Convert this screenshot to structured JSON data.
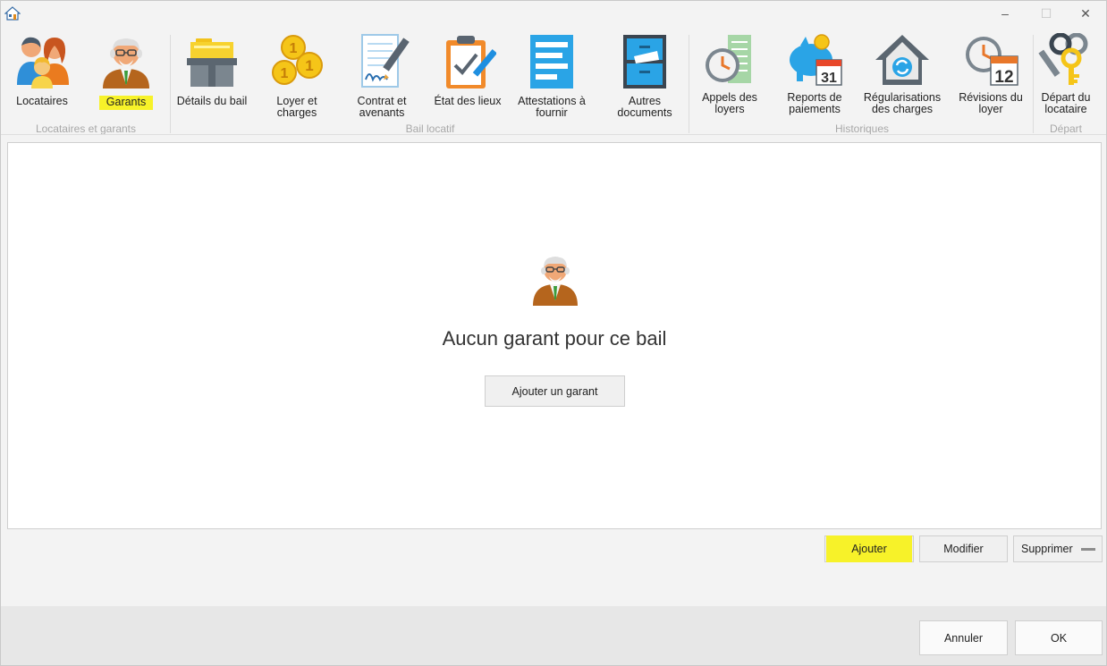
{
  "window": {
    "app_icon": "house-icon",
    "controls": {
      "minimize": "–",
      "maximize": "☐",
      "close": "✕"
    }
  },
  "ribbon": {
    "groups": [
      {
        "label": "Locataires et garants"
      },
      {
        "label": "Bail locatif"
      },
      {
        "label": "Historiques"
      },
      {
        "label": "Départ"
      }
    ],
    "buttons": {
      "locataires": "Locataires",
      "garants": "Garants",
      "details_bail": "Détails du bail",
      "loyer_charges": "Loyer et\ncharges",
      "contrat": "Contrat et\navenants",
      "etat_lieux": "État des lieux",
      "attestations": "Attestations à\nfournir",
      "autres_docs": "Autres\ndocuments",
      "appels": "Appels des\nloyers",
      "reports": "Reports de\npaiements",
      "regularisations": "Régularisations\ndes charges",
      "revisions": "Révisions du\nloyer",
      "depart": "Départ du\nlocataire"
    },
    "calendar_days": {
      "reports": "31",
      "revisions": "12"
    }
  },
  "panel": {
    "empty_message": "Aucun garant pour ce bail",
    "add_inline_button": "Ajouter un garant"
  },
  "actions": {
    "ajouter": "Ajouter",
    "modifier": "Modifier",
    "supprimer": "Supprimer"
  },
  "footer": {
    "annuler": "Annuler",
    "ok": "OK"
  },
  "colors": {
    "highlight": "#f7f229",
    "coin": "#f5c518",
    "blue_doc": "#2aa4e6"
  }
}
